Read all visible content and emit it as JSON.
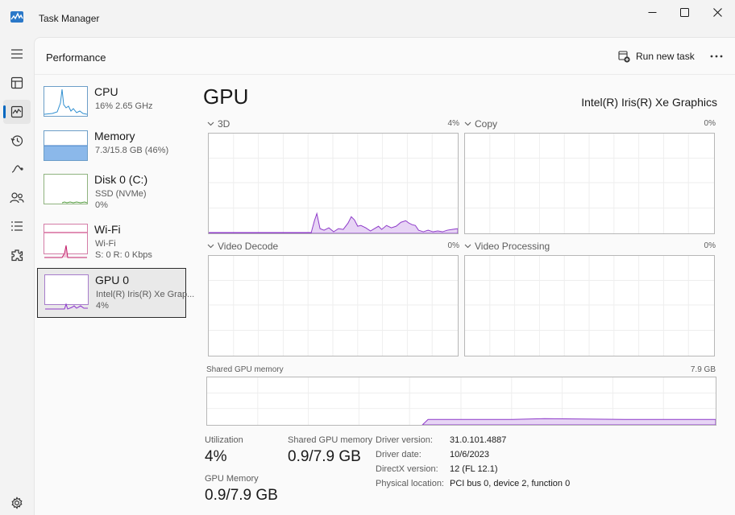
{
  "window": {
    "title": "Task Manager"
  },
  "rail": {
    "items": [
      "hamburger-menu-icon",
      "processes-icon",
      "performance-icon",
      "app-history-icon",
      "startup-apps-icon",
      "users-icon",
      "details-icon",
      "services-icon",
      "settings-icon"
    ],
    "active": "performance-icon"
  },
  "header": {
    "title": "Performance",
    "run_task_label": "Run new task"
  },
  "resources": [
    {
      "name": "CPU",
      "sub1": "16%  2.65 GHz",
      "sub2": ""
    },
    {
      "name": "Memory",
      "sub1": "7.3/15.8 GB (46%)",
      "sub2": ""
    },
    {
      "name": "Disk 0 (C:)",
      "sub1": "SSD (NVMe)",
      "sub2": "0%"
    },
    {
      "name": "Wi-Fi",
      "sub1": "Wi-Fi",
      "sub2": "S: 0  R: 0 Kbps"
    },
    {
      "name": "GPU 0",
      "sub1": "Intel(R) Iris(R) Xe Grap...",
      "sub2": "4%"
    }
  ],
  "gpu": {
    "title": "GPU",
    "model": "Intel(R) Iris(R) Xe Graphics",
    "engines": [
      {
        "name": "3D",
        "pct": "4%"
      },
      {
        "name": "Copy",
        "pct": "0%"
      },
      {
        "name": "Video Decode",
        "pct": "0%"
      },
      {
        "name": "Video Processing",
        "pct": "0%"
      }
    ],
    "shared_memory_graph": {
      "label": "Shared GPU memory",
      "max": "7.9 GB"
    },
    "stats": {
      "utilization_label": "Utilization",
      "utilization_value": "4%",
      "shared_label": "Shared GPU memory",
      "shared_value": "0.9/7.9 GB",
      "gpu_memory_label": "GPU Memory",
      "gpu_memory_value": "0.9/7.9 GB"
    },
    "info": [
      {
        "key": "Driver version:",
        "value": "31.0.101.4887"
      },
      {
        "key": "Driver date:",
        "value": "10/6/2023"
      },
      {
        "key": "DirectX version:",
        "value": "12 (FL 12.1)"
      },
      {
        "key": "Physical location:",
        "value": "PCI bus 0, device 2, function 0"
      }
    ]
  },
  "colors": {
    "gpu_fill": "#e7d4f5",
    "gpu_line": "#8e3bc9",
    "cpu_line": "#2f8fd0",
    "memory_fill": "#8bb8ea",
    "disk_line": "#4f9a3a",
    "wifi_line": "#c3206b",
    "accent": "#0067c0"
  }
}
